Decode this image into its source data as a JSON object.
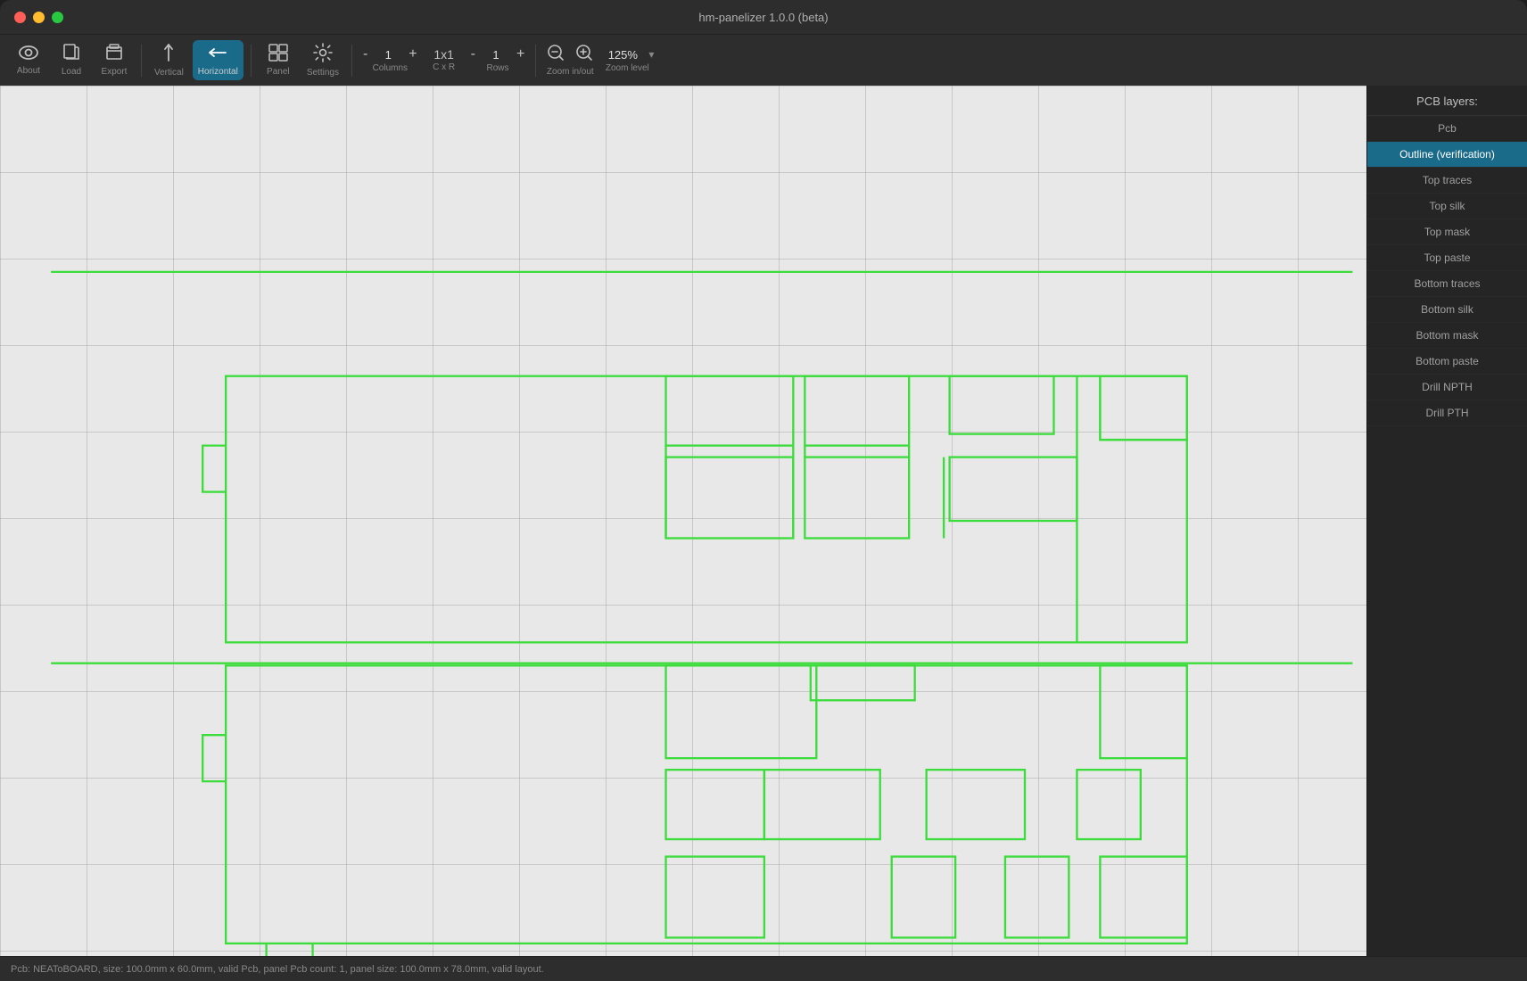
{
  "window": {
    "title": "hm-panelizer 1.0.0 (beta)"
  },
  "toolbar": {
    "about_label": "About",
    "load_label": "Load",
    "export_label": "Export",
    "vertical_label": "Vertical",
    "horizontal_label": "Horizontal",
    "panel_label": "Panel",
    "settings_label": "Settings",
    "columns_label": "Columns",
    "cxr_label": "C x R",
    "rows_label": "Rows",
    "zoom_inout_label": "Zoom in/out",
    "zoom_level_label": "Zoom level",
    "columns_minus": "-",
    "columns_plus": "+",
    "columns_value": "1",
    "rows_minus": "-",
    "rows_plus": "+",
    "rows_value": "1",
    "cxr_value": "1x1",
    "zoom_minus": "-",
    "zoom_plus": "+",
    "zoom_value": "125%"
  },
  "layers": {
    "title": "PCB layers:",
    "items": [
      {
        "id": "pcb",
        "label": "Pcb",
        "active": false
      },
      {
        "id": "outline",
        "label": "Outline (verification)",
        "active": true
      },
      {
        "id": "top-traces",
        "label": "Top traces",
        "active": false
      },
      {
        "id": "top-silk",
        "label": "Top silk",
        "active": false
      },
      {
        "id": "top-mask",
        "label": "Top mask",
        "active": false
      },
      {
        "id": "top-paste",
        "label": "Top paste",
        "active": false
      },
      {
        "id": "bottom-traces",
        "label": "Bottom traces",
        "active": false
      },
      {
        "id": "bottom-silk",
        "label": "Bottom silk",
        "active": false
      },
      {
        "id": "bottom-mask",
        "label": "Bottom mask",
        "active": false
      },
      {
        "id": "bottom-paste",
        "label": "Bottom paste",
        "active": false
      },
      {
        "id": "drill-npth",
        "label": "Drill NPTH",
        "active": false
      },
      {
        "id": "drill-pth",
        "label": "Drill PTH",
        "active": false
      }
    ]
  },
  "status": {
    "text": "Pcb: NEAToBOARD,  size: 100.0mm x 60.0mm, valid Pcb,  panel Pcb count: 1, panel size: 100.0mm x 78.0mm, valid layout."
  },
  "colors": {
    "active_layer": "#1a6b8a",
    "pcb_outline": "#3ddc3d",
    "grid": "#969696"
  }
}
